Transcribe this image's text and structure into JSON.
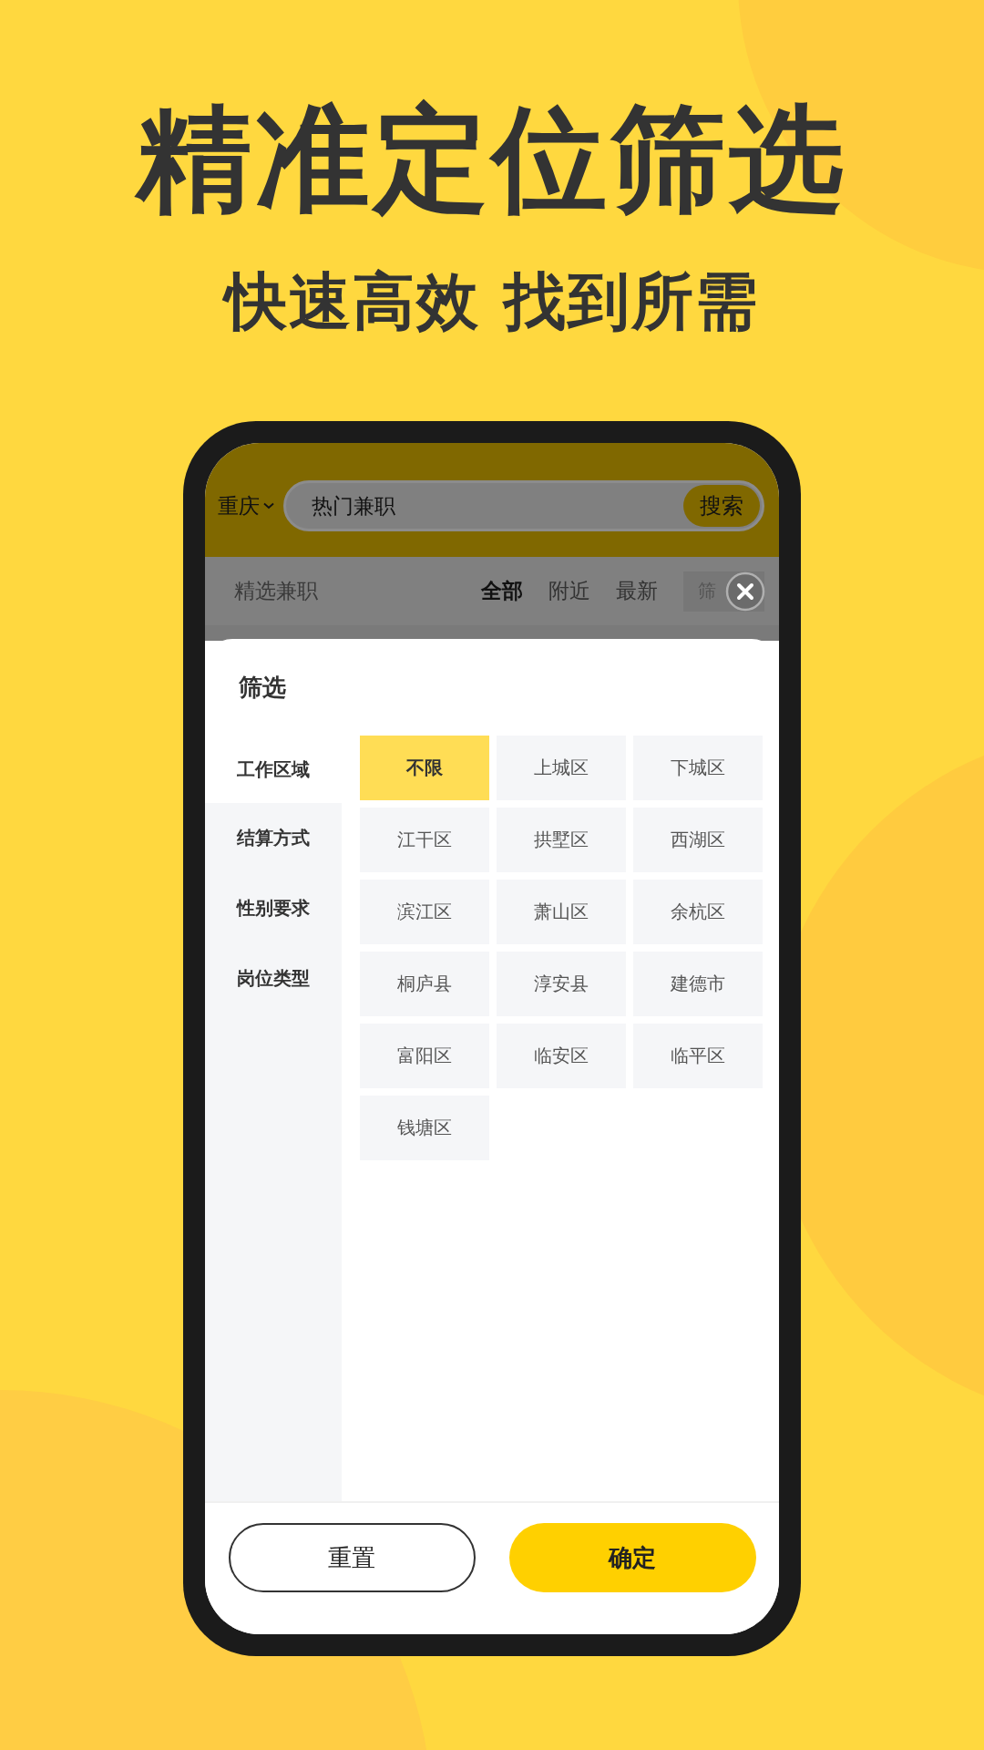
{
  "headline": "精准定位筛选",
  "subheadline": "快速高效 找到所需",
  "app": {
    "city": "重庆",
    "search": {
      "value": "热门兼职",
      "button": "搜索"
    },
    "section_title": "精选兼职",
    "tabs": [
      {
        "label": "全部",
        "selected": true
      },
      {
        "label": "附近",
        "selected": false
      },
      {
        "label": "最新",
        "selected": false
      }
    ],
    "filter_button": "筛"
  },
  "filter_sheet": {
    "title": "筛选",
    "categories": [
      {
        "label": "工作区域",
        "selected": true
      },
      {
        "label": "结算方式",
        "selected": false
      },
      {
        "label": "性别要求",
        "selected": false
      },
      {
        "label": "岗位类型",
        "selected": false
      }
    ],
    "options": [
      {
        "label": "不限",
        "selected": true
      },
      {
        "label": "上城区",
        "selected": false
      },
      {
        "label": "下城区",
        "selected": false
      },
      {
        "label": "江干区",
        "selected": false
      },
      {
        "label": "拱墅区",
        "selected": false
      },
      {
        "label": "西湖区",
        "selected": false
      },
      {
        "label": "滨江区",
        "selected": false
      },
      {
        "label": "萧山区",
        "selected": false
      },
      {
        "label": "余杭区",
        "selected": false
      },
      {
        "label": "桐庐县",
        "selected": false
      },
      {
        "label": "淳安县",
        "selected": false
      },
      {
        "label": "建德市",
        "selected": false
      },
      {
        "label": "富阳区",
        "selected": false
      },
      {
        "label": "临安区",
        "selected": false
      },
      {
        "label": "临平区",
        "selected": false
      },
      {
        "label": "钱塘区",
        "selected": false
      }
    ],
    "buttons": [
      {
        "label": "重置",
        "kind": "secondary"
      },
      {
        "label": "确定",
        "kind": "primary"
      }
    ]
  }
}
